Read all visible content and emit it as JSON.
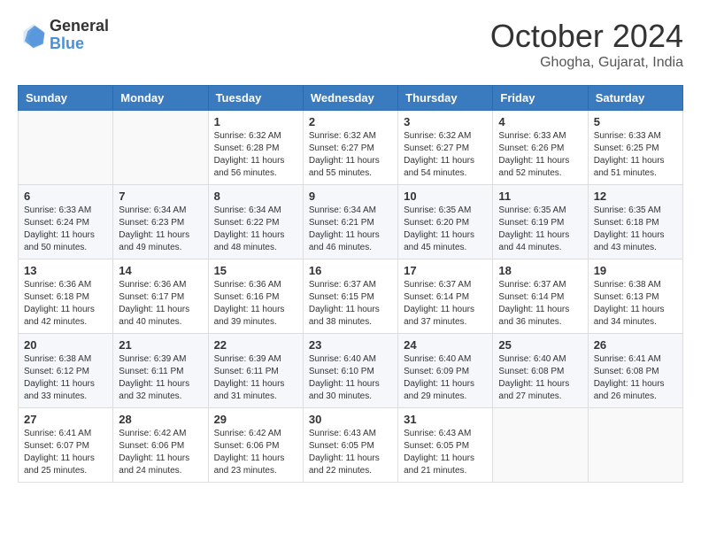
{
  "header": {
    "logo_line1": "General",
    "logo_line2": "Blue",
    "month": "October 2024",
    "location": "Ghogha, Gujarat, India"
  },
  "weekdays": [
    "Sunday",
    "Monday",
    "Tuesday",
    "Wednesday",
    "Thursday",
    "Friday",
    "Saturday"
  ],
  "weeks": [
    [
      {
        "day": "",
        "info": ""
      },
      {
        "day": "",
        "info": ""
      },
      {
        "day": "1",
        "info": "Sunrise: 6:32 AM\nSunset: 6:28 PM\nDaylight: 11 hours and 56 minutes."
      },
      {
        "day": "2",
        "info": "Sunrise: 6:32 AM\nSunset: 6:27 PM\nDaylight: 11 hours and 55 minutes."
      },
      {
        "day": "3",
        "info": "Sunrise: 6:32 AM\nSunset: 6:27 PM\nDaylight: 11 hours and 54 minutes."
      },
      {
        "day": "4",
        "info": "Sunrise: 6:33 AM\nSunset: 6:26 PM\nDaylight: 11 hours and 52 minutes."
      },
      {
        "day": "5",
        "info": "Sunrise: 6:33 AM\nSunset: 6:25 PM\nDaylight: 11 hours and 51 minutes."
      }
    ],
    [
      {
        "day": "6",
        "info": "Sunrise: 6:33 AM\nSunset: 6:24 PM\nDaylight: 11 hours and 50 minutes."
      },
      {
        "day": "7",
        "info": "Sunrise: 6:34 AM\nSunset: 6:23 PM\nDaylight: 11 hours and 49 minutes."
      },
      {
        "day": "8",
        "info": "Sunrise: 6:34 AM\nSunset: 6:22 PM\nDaylight: 11 hours and 48 minutes."
      },
      {
        "day": "9",
        "info": "Sunrise: 6:34 AM\nSunset: 6:21 PM\nDaylight: 11 hours and 46 minutes."
      },
      {
        "day": "10",
        "info": "Sunrise: 6:35 AM\nSunset: 6:20 PM\nDaylight: 11 hours and 45 minutes."
      },
      {
        "day": "11",
        "info": "Sunrise: 6:35 AM\nSunset: 6:19 PM\nDaylight: 11 hours and 44 minutes."
      },
      {
        "day": "12",
        "info": "Sunrise: 6:35 AM\nSunset: 6:18 PM\nDaylight: 11 hours and 43 minutes."
      }
    ],
    [
      {
        "day": "13",
        "info": "Sunrise: 6:36 AM\nSunset: 6:18 PM\nDaylight: 11 hours and 42 minutes."
      },
      {
        "day": "14",
        "info": "Sunrise: 6:36 AM\nSunset: 6:17 PM\nDaylight: 11 hours and 40 minutes."
      },
      {
        "day": "15",
        "info": "Sunrise: 6:36 AM\nSunset: 6:16 PM\nDaylight: 11 hours and 39 minutes."
      },
      {
        "day": "16",
        "info": "Sunrise: 6:37 AM\nSunset: 6:15 PM\nDaylight: 11 hours and 38 minutes."
      },
      {
        "day": "17",
        "info": "Sunrise: 6:37 AM\nSunset: 6:14 PM\nDaylight: 11 hours and 37 minutes."
      },
      {
        "day": "18",
        "info": "Sunrise: 6:37 AM\nSunset: 6:14 PM\nDaylight: 11 hours and 36 minutes."
      },
      {
        "day": "19",
        "info": "Sunrise: 6:38 AM\nSunset: 6:13 PM\nDaylight: 11 hours and 34 minutes."
      }
    ],
    [
      {
        "day": "20",
        "info": "Sunrise: 6:38 AM\nSunset: 6:12 PM\nDaylight: 11 hours and 33 minutes."
      },
      {
        "day": "21",
        "info": "Sunrise: 6:39 AM\nSunset: 6:11 PM\nDaylight: 11 hours and 32 minutes."
      },
      {
        "day": "22",
        "info": "Sunrise: 6:39 AM\nSunset: 6:11 PM\nDaylight: 11 hours and 31 minutes."
      },
      {
        "day": "23",
        "info": "Sunrise: 6:40 AM\nSunset: 6:10 PM\nDaylight: 11 hours and 30 minutes."
      },
      {
        "day": "24",
        "info": "Sunrise: 6:40 AM\nSunset: 6:09 PM\nDaylight: 11 hours and 29 minutes."
      },
      {
        "day": "25",
        "info": "Sunrise: 6:40 AM\nSunset: 6:08 PM\nDaylight: 11 hours and 27 minutes."
      },
      {
        "day": "26",
        "info": "Sunrise: 6:41 AM\nSunset: 6:08 PM\nDaylight: 11 hours and 26 minutes."
      }
    ],
    [
      {
        "day": "27",
        "info": "Sunrise: 6:41 AM\nSunset: 6:07 PM\nDaylight: 11 hours and 25 minutes."
      },
      {
        "day": "28",
        "info": "Sunrise: 6:42 AM\nSunset: 6:06 PM\nDaylight: 11 hours and 24 minutes."
      },
      {
        "day": "29",
        "info": "Sunrise: 6:42 AM\nSunset: 6:06 PM\nDaylight: 11 hours and 23 minutes."
      },
      {
        "day": "30",
        "info": "Sunrise: 6:43 AM\nSunset: 6:05 PM\nDaylight: 11 hours and 22 minutes."
      },
      {
        "day": "31",
        "info": "Sunrise: 6:43 AM\nSunset: 6:05 PM\nDaylight: 11 hours and 21 minutes."
      },
      {
        "day": "",
        "info": ""
      },
      {
        "day": "",
        "info": ""
      }
    ]
  ]
}
